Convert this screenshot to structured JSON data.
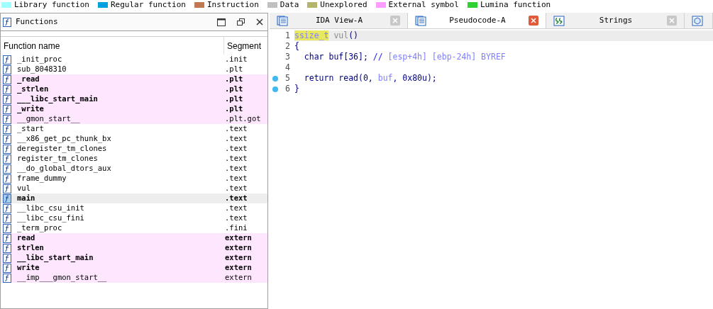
{
  "legend": [
    {
      "label": "Library function",
      "color": "#a0ffff"
    },
    {
      "label": "Regular function",
      "color": "#00a0e0"
    },
    {
      "label": "Instruction",
      "color": "#c07850"
    },
    {
      "label": "Data",
      "color": "#c0c0c0"
    },
    {
      "label": "Unexplored",
      "color": "#b4b46c"
    },
    {
      "label": "External symbol",
      "color": "#ff9cff"
    },
    {
      "label": "Lumina function",
      "color": "#30d030"
    }
  ],
  "functions_panel": {
    "title": "Functions",
    "columns": [
      "Function name",
      "Segment"
    ],
    "rows": [
      {
        "name": "_init_proc",
        "segment": ".init",
        "highlighted": false,
        "bold": false,
        "selected": false
      },
      {
        "name": "sub_8048310",
        "segment": ".plt",
        "highlighted": false,
        "bold": false,
        "selected": false
      },
      {
        "name": "_read",
        "segment": ".plt",
        "highlighted": true,
        "bold": true,
        "selected": false
      },
      {
        "name": "_strlen",
        "segment": ".plt",
        "highlighted": true,
        "bold": true,
        "selected": false
      },
      {
        "name": "___libc_start_main",
        "segment": ".plt",
        "highlighted": true,
        "bold": true,
        "selected": false
      },
      {
        "name": "_write",
        "segment": ".plt",
        "highlighted": true,
        "bold": true,
        "selected": false
      },
      {
        "name": "__gmon_start__",
        "segment": ".plt.got",
        "highlighted": true,
        "bold": false,
        "selected": false
      },
      {
        "name": "_start",
        "segment": ".text",
        "highlighted": false,
        "bold": false,
        "selected": false
      },
      {
        "name": "__x86_get_pc_thunk_bx",
        "segment": ".text",
        "highlighted": false,
        "bold": false,
        "selected": false
      },
      {
        "name": "deregister_tm_clones",
        "segment": ".text",
        "highlighted": false,
        "bold": false,
        "selected": false
      },
      {
        "name": "register_tm_clones",
        "segment": ".text",
        "highlighted": false,
        "bold": false,
        "selected": false
      },
      {
        "name": "__do_global_dtors_aux",
        "segment": ".text",
        "highlighted": false,
        "bold": false,
        "selected": false
      },
      {
        "name": "frame_dummy",
        "segment": ".text",
        "highlighted": false,
        "bold": false,
        "selected": false
      },
      {
        "name": "vul",
        "segment": ".text",
        "highlighted": false,
        "bold": false,
        "selected": false
      },
      {
        "name": "main",
        "segment": ".text",
        "highlighted": false,
        "bold": true,
        "selected": true
      },
      {
        "name": "__libc_csu_init",
        "segment": ".text",
        "highlighted": false,
        "bold": false,
        "selected": false
      },
      {
        "name": "__libc_csu_fini",
        "segment": ".text",
        "highlighted": false,
        "bold": false,
        "selected": false
      },
      {
        "name": "_term_proc",
        "segment": ".fini",
        "highlighted": false,
        "bold": false,
        "selected": false
      },
      {
        "name": "read",
        "segment": "extern",
        "highlighted": true,
        "bold": true,
        "selected": false
      },
      {
        "name": "strlen",
        "segment": "extern",
        "highlighted": true,
        "bold": true,
        "selected": false
      },
      {
        "name": "__libc_start_main",
        "segment": "extern",
        "highlighted": true,
        "bold": true,
        "selected": false
      },
      {
        "name": "write",
        "segment": "extern",
        "highlighted": true,
        "bold": true,
        "selected": false
      },
      {
        "name": "__imp___gmon_start__",
        "segment": "extern",
        "highlighted": true,
        "bold": false,
        "selected": false
      }
    ]
  },
  "tabs": [
    {
      "label": "IDA View-A",
      "kind": "listing",
      "selected": false
    },
    {
      "label": "Pseudocode-A",
      "kind": "listing",
      "selected": true
    },
    {
      "label": "Strings",
      "kind": "strings",
      "selected": false
    },
    {
      "kind": "hex",
      "selected": false
    }
  ],
  "code": [
    {
      "number": "1",
      "breakpoint": false,
      "current": true,
      "tokens": [
        {
          "text": "ssize_t",
          "kind": "highlight"
        },
        {
          "text": " vul",
          "kind": "gray"
        },
        {
          "text": "()",
          "kind": "plain"
        }
      ]
    },
    {
      "number": "2",
      "breakpoint": false,
      "current": false,
      "tokens": [
        {
          "text": "{",
          "kind": "plain"
        }
      ]
    },
    {
      "number": "3",
      "breakpoint": false,
      "current": false,
      "tokens": [
        {
          "text": "  char buf[36]; ",
          "kind": "plain"
        },
        {
          "text": "// ",
          "kind": "comment"
        },
        {
          "text": "[esp+4h] [ebp-24h] BYREF",
          "kind": "faint"
        }
      ]
    },
    {
      "number": "4",
      "breakpoint": false,
      "current": false
    },
    {
      "number": "5",
      "breakpoint": true,
      "current": false,
      "tokens": [
        {
          "text": "  return read(0, ",
          "kind": "plain"
        },
        {
          "text": "buf",
          "kind": "faint"
        },
        {
          "text": ", 0x80u);",
          "kind": "plain"
        }
      ]
    },
    {
      "number": "6",
      "breakpoint": true,
      "current": false,
      "tokens": [
        {
          "text": "}",
          "kind": "plain"
        }
      ]
    }
  ]
}
